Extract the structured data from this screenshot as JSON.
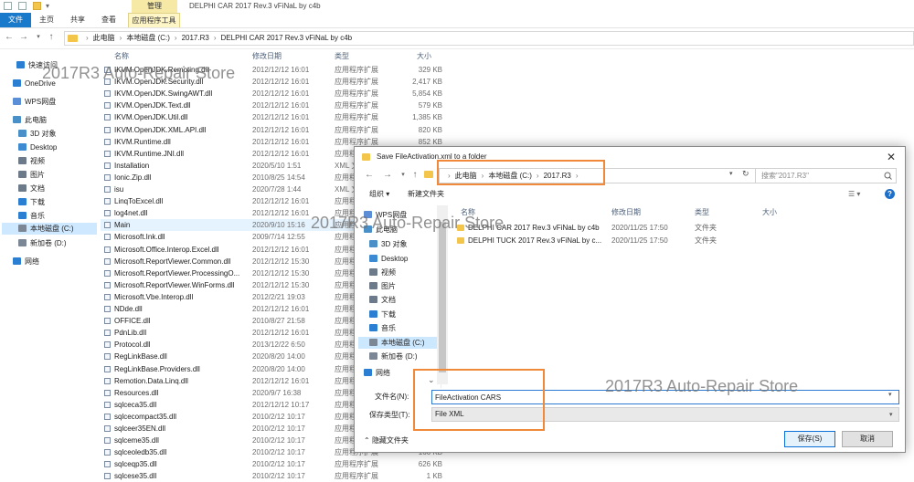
{
  "window": {
    "title": "DELPHI CAR 2017  Rev.3 vFiNaL by c4b",
    "manage_tab": "管理",
    "tabs": [
      {
        "label": "文件"
      },
      {
        "label": "主页"
      },
      {
        "label": "共享"
      },
      {
        "label": "查看"
      },
      {
        "label": "应用程序工具"
      }
    ]
  },
  "address": {
    "crumbs": [
      "此电脑",
      "本地磁盘 (C:)",
      "2017.R3",
      "DELPHI CAR 2017  Rev.3 vFiNaL by c4b"
    ]
  },
  "nav": {
    "items": [
      {
        "label": "快速访问",
        "icon": "star-icon",
        "color": "#2b7fd3"
      },
      {
        "label": "OneDrive",
        "icon": "cloud-icon",
        "color": "#2b7fd3"
      },
      {
        "label": "WPS网盘",
        "icon": "cloud-icon",
        "color": "#5a8fd8"
      },
      {
        "label": "此电脑",
        "icon": "computer-icon",
        "color": "#4a90c8"
      },
      {
        "label": "3D 对象",
        "icon": "cube-icon",
        "color": "#4a90c8"
      },
      {
        "label": "Desktop",
        "icon": "desktop-icon",
        "color": "#3c8ad2"
      },
      {
        "label": "视频",
        "icon": "video-icon",
        "color": "#6c7a8a"
      },
      {
        "label": "图片",
        "icon": "pictures-icon",
        "color": "#6c7a8a"
      },
      {
        "label": "文档",
        "icon": "documents-icon",
        "color": "#6c7a8a"
      },
      {
        "label": "下载",
        "icon": "download-icon",
        "color": "#2b7fd3"
      },
      {
        "label": "音乐",
        "icon": "music-icon",
        "color": "#2b7fd3"
      },
      {
        "label": "本地磁盘 (C:)",
        "icon": "drive-icon",
        "color": "#7b8794"
      },
      {
        "label": "新加卷 (D:)",
        "icon": "drive-icon",
        "color": "#7b8794"
      },
      {
        "label": "网络",
        "icon": "network-icon",
        "color": "#2b7fd3"
      }
    ]
  },
  "filelist": {
    "columns": [
      "名称",
      "修改日期",
      "类型",
      "大小"
    ],
    "rows": [
      {
        "name": "IKVM.OpenJDK.Remoting.dll",
        "date": "2012/12/12 16:01",
        "type": "应用程序扩展",
        "size": "329 KB"
      },
      {
        "name": "IKVM.OpenJDK.Security.dll",
        "date": "2012/12/12 16:01",
        "type": "应用程序扩展",
        "size": "2,417 KB"
      },
      {
        "name": "IKVM.OpenJDK.SwingAWT.dll",
        "date": "2012/12/12 16:01",
        "type": "应用程序扩展",
        "size": "5,854 KB"
      },
      {
        "name": "IKVM.OpenJDK.Text.dll",
        "date": "2012/12/12 16:01",
        "type": "应用程序扩展",
        "size": "579 KB"
      },
      {
        "name": "IKVM.OpenJDK.Util.dll",
        "date": "2012/12/12 16:01",
        "type": "应用程序扩展",
        "size": "1,385 KB"
      },
      {
        "name": "IKVM.OpenJDK.XML.API.dll",
        "date": "2012/12/12 16:01",
        "type": "应用程序扩展",
        "size": "820 KB"
      },
      {
        "name": "IKVM.Runtime.dll",
        "date": "2012/12/12 16:01",
        "type": "应用程序扩展",
        "size": "852 KB"
      },
      {
        "name": "IKVM.Runtime.JNI.dll",
        "date": "2012/12/12 16:01",
        "type": "应用程序扩展",
        "size": ""
      },
      {
        "name": "Installation",
        "date": "2020/5/10 1:51",
        "type": "XML 文",
        "size": ""
      },
      {
        "name": "Ionic.Zip.dll",
        "date": "2010/8/25 14:54",
        "type": "应用程",
        "size": ""
      },
      {
        "name": "isu",
        "date": "2020/7/28 1:44",
        "type": "XML 文",
        "size": ""
      },
      {
        "name": "LinqToExcel.dll",
        "date": "2012/12/12 16:01",
        "type": "应用程",
        "size": ""
      },
      {
        "name": "log4net.dll",
        "date": "2012/12/12 16:01",
        "type": "应用程",
        "size": ""
      },
      {
        "name": "Main",
        "date": "2020/9/10 15:16",
        "type": "应用程",
        "size": ""
      },
      {
        "name": "Microsoft.Ink.dll",
        "date": "2009/7/14 12:55",
        "type": "应用程",
        "size": ""
      },
      {
        "name": "Microsoft.Office.Interop.Excel.dll",
        "date": "2012/12/12 16:01",
        "type": "应用程",
        "size": ""
      },
      {
        "name": "Microsoft.ReportViewer.Common.dll",
        "date": "2012/12/12 15:30",
        "type": "应用程",
        "size": ""
      },
      {
        "name": "Microsoft.ReportViewer.ProcessingO...",
        "date": "2012/12/12 15:30",
        "type": "应用程",
        "size": ""
      },
      {
        "name": "Microsoft.ReportViewer.WinForms.dll",
        "date": "2012/12/12 15:30",
        "type": "应用程",
        "size": ""
      },
      {
        "name": "Microsoft.Vbe.Interop.dll",
        "date": "2012/2/21 19:03",
        "type": "应用程",
        "size": ""
      },
      {
        "name": "NDde.dll",
        "date": "2012/12/12 16:01",
        "type": "应用程",
        "size": ""
      },
      {
        "name": "OFFICE.dll",
        "date": "2010/8/27 21:58",
        "type": "应用程",
        "size": ""
      },
      {
        "name": "PdnLib.dll",
        "date": "2012/12/12 16:01",
        "type": "应用程",
        "size": ""
      },
      {
        "name": "Protocol.dll",
        "date": "2013/12/22 6:50",
        "type": "应用程",
        "size": ""
      },
      {
        "name": "RegLinkBase.dll",
        "date": "2020/8/20 14:00",
        "type": "应用程",
        "size": ""
      },
      {
        "name": "RegLinkBase.Providers.dll",
        "date": "2020/8/20 14:00",
        "type": "应用程",
        "size": ""
      },
      {
        "name": "Remotion.Data.Linq.dll",
        "date": "2012/12/12 16:01",
        "type": "应用程",
        "size": ""
      },
      {
        "name": "Resources.dll",
        "date": "2020/9/7 16:38",
        "type": "应用程",
        "size": ""
      },
      {
        "name": "sqlceca35.dll",
        "date": "2012/12/12 10:17",
        "type": "应用程",
        "size": ""
      },
      {
        "name": "sqlcecompact35.dll",
        "date": "2010/2/12 10:17",
        "type": "应用程",
        "size": ""
      },
      {
        "name": "sqlceer35EN.dll",
        "date": "2010/2/12 10:17",
        "type": "应用程",
        "size": ""
      },
      {
        "name": "sqlceme35.dll",
        "date": "2010/2/12 10:17",
        "type": "应用程",
        "size": ""
      },
      {
        "name": "sqlceoledb35.dll",
        "date": "2010/2/12 10:17",
        "type": "应用程序扩展",
        "size": "166 KB"
      },
      {
        "name": "sqlceqp35.dll",
        "date": "2010/2/12 10:17",
        "type": "应用程序扩展",
        "size": "626 KB"
      },
      {
        "name": "sqlcese35.dll",
        "date": "2010/2/12 10:17",
        "type": "应用程序扩展",
        "size": "1 KB"
      }
    ]
  },
  "dialog": {
    "title": "Save FileActivation.xml to a folder",
    "crumbs": [
      "此电脑",
      "本地磁盘 (C:)",
      "2017.R3"
    ],
    "search_placeholder": "搜索\"2017.R3\"",
    "organize": "组织 ▾",
    "new_folder": "新建文件夹",
    "columns": [
      "名称",
      "修改日期",
      "类型",
      "大小"
    ],
    "nav": [
      {
        "label": "WPS网盘",
        "icon": "cloud-icon"
      },
      {
        "label": "此电脑",
        "icon": "computer-icon"
      },
      {
        "label": "3D 对象",
        "icon": "cube-icon"
      },
      {
        "label": "Desktop",
        "icon": "desktop-icon"
      },
      {
        "label": "视频",
        "icon": "video-icon"
      },
      {
        "label": "图片",
        "icon": "pictures-icon"
      },
      {
        "label": "文档",
        "icon": "documents-icon"
      },
      {
        "label": "下载",
        "icon": "download-icon"
      },
      {
        "label": "音乐",
        "icon": "music-icon"
      },
      {
        "label": "本地磁盘 (C:)",
        "icon": "drive-icon"
      },
      {
        "label": "新加卷 (D:)",
        "icon": "drive-icon"
      },
      {
        "label": "网络",
        "icon": "network-icon"
      }
    ],
    "rows": [
      {
        "name": "DELPHI CAR 2017  Rev.3 vFiNaL by c4b",
        "date": "2020/11/25 17:50",
        "type": "文件夹"
      },
      {
        "name": "DELPHI TUCK 2017 Rev.3 vFiNaL by c...",
        "date": "2020/11/25 17:50",
        "type": "文件夹"
      }
    ],
    "filename_label": "文件名(N):",
    "filename_value": "FileActivation CARS",
    "filetype_label": "保存类型(T):",
    "filetype_value": "File XML",
    "hide_folders": "隐藏文件夹",
    "save_label": "保存(S)",
    "cancel_label": "取消"
  },
  "watermark": "2017R3 Auto-Repair Store",
  "colors": {
    "highlight": "#f08a3a",
    "file_tab": "#1979ca",
    "folder": "#f3c64b",
    "manage_tab": "#f6e9a6"
  }
}
